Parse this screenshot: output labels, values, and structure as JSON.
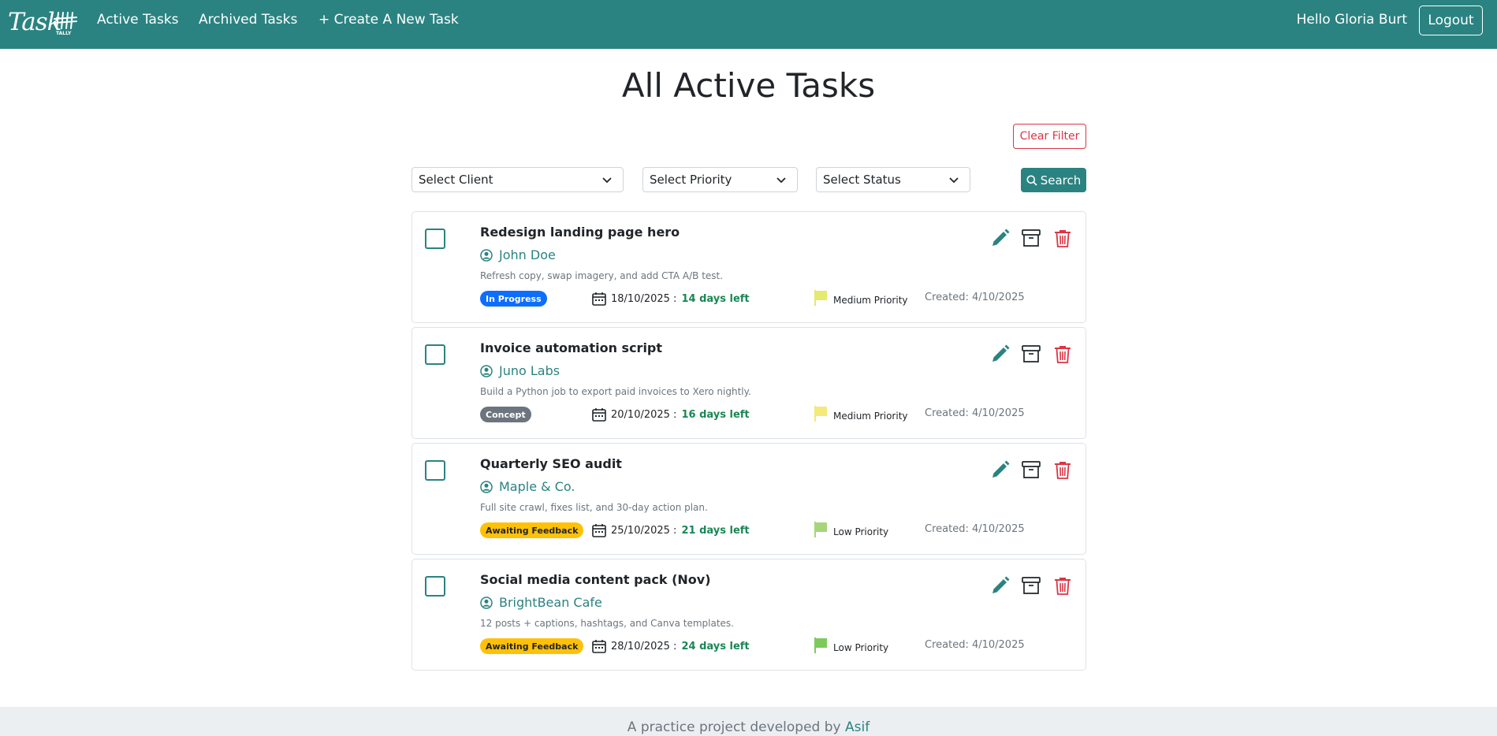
{
  "nav": {
    "brand_script": "Task",
    "brand_sub": "TALLY",
    "active_tasks": "Active Tasks",
    "archived_tasks": "Archived Tasks",
    "create_task": "+ Create A New Task",
    "greeting": "Hello Gloria Burt",
    "logout": "Logout"
  },
  "page": {
    "title": "All Active Tasks",
    "clear_filter": "Clear Filter"
  },
  "filters": {
    "client": "Select Client",
    "priority": "Select Priority",
    "status": "Select Status",
    "search": "Search"
  },
  "tasks": [
    {
      "title": "Redesign landing page hero",
      "client": "John Doe",
      "description": "Refresh copy, swap imagery, and add CTA A/B test.",
      "status": "In Progress",
      "status_bg": "#0d6efd",
      "status_fg": "#ffffff",
      "due_date": "18/10/2025 :",
      "days_left": "14 days left",
      "priority": "Medium Priority",
      "priority_color": "#e3ea6e",
      "created": "Created: 4/10/2025"
    },
    {
      "title": "Invoice automation script",
      "client": "Juno Labs",
      "description": "Build a Python job to export paid invoices to Xero nightly.",
      "status": "Concept",
      "status_bg": "#6c757d",
      "status_fg": "#ffffff",
      "due_date": "20/10/2025 :",
      "days_left": "16 days left",
      "priority": "Medium Priority",
      "priority_color": "#f3ea7a",
      "created": "Created: 4/10/2025"
    },
    {
      "title": "Quarterly SEO audit",
      "client": "Maple & Co.",
      "description": "Full site crawl, fixes list, and 30-day action plan.",
      "status": "Awaiting Feedback",
      "status_bg": "#ffc107",
      "status_fg": "#212529",
      "due_date": "25/10/2025 :",
      "days_left": "21 days left",
      "priority": "Low Priority",
      "priority_color": "#a5d67a",
      "created": "Created: 4/10/2025"
    },
    {
      "title": "Social media content pack (Nov)",
      "client": "BrightBean Cafe",
      "description": "12 posts + captions, hashtags, and Canva templates.",
      "status": "Awaiting Feedback",
      "status_bg": "#ffc107",
      "status_fg": "#212529",
      "due_date": "28/10/2025 :",
      "days_left": "24 days left",
      "priority": "Low Priority",
      "priority_color": "#7ccb5a",
      "created": "Created: 4/10/2025"
    }
  ],
  "footer": {
    "text": "A practice project developed by",
    "author": "Asif"
  },
  "colors": {
    "brand": "#2a8381",
    "danger": "#dc3545",
    "success": "#198754"
  }
}
